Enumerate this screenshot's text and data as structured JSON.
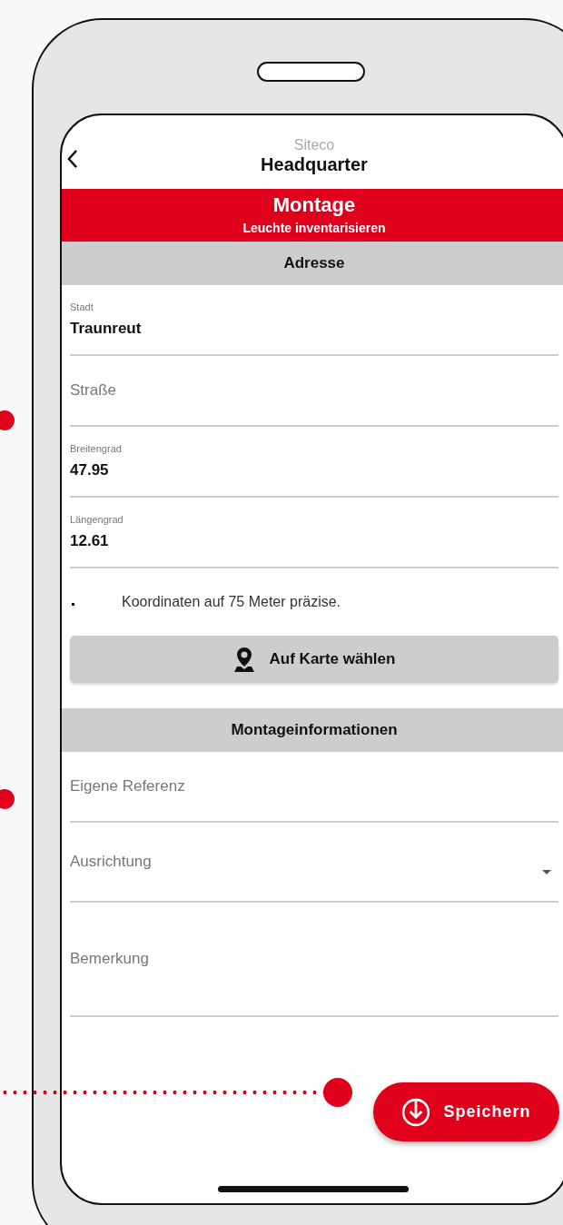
{
  "header": {
    "subtitle": "Siteco",
    "title": "Headquarter"
  },
  "banner": {
    "title": "Montage",
    "subtitle": "Leuchte inventarisieren"
  },
  "sections": [
    {
      "heading": "Adresse",
      "fields": [
        {
          "kind": "text",
          "label": "Stadt",
          "value": "Traunreut"
        },
        {
          "kind": "text",
          "placeholder": "Straße"
        },
        {
          "kind": "text",
          "label": "Breitengrad",
          "value": "47.95"
        },
        {
          "kind": "text",
          "label": "Längengrad",
          "value": "12.61"
        }
      ],
      "note": "Koordinaten auf 75 Meter präzise.",
      "map_button": "Auf Karte wählen"
    },
    {
      "heading": "Montageinformationen",
      "fields": [
        {
          "kind": "text",
          "placeholder": "Eigene Referenz"
        },
        {
          "kind": "select",
          "placeholder": "Ausrichtung"
        },
        {
          "kind": "multiline",
          "placeholder": "Bemerkung"
        }
      ]
    }
  ],
  "fab": {
    "label": "Speichern"
  }
}
